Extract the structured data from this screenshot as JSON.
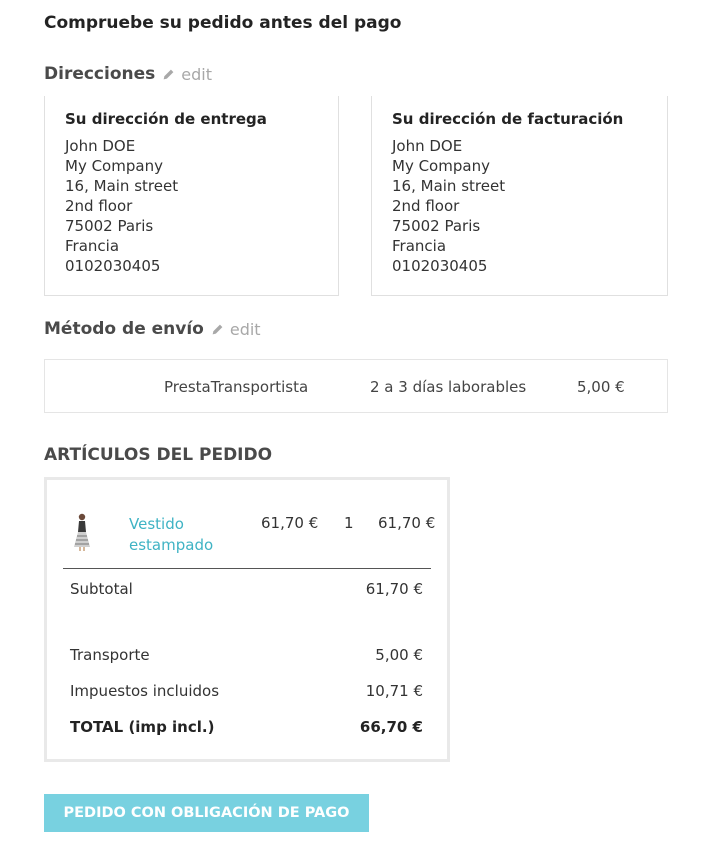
{
  "page_title": "Compruebe su pedido antes del pago",
  "addresses": {
    "section_title": "Direcciones",
    "edit_label": "edit",
    "delivery": {
      "title": "Su dirección de entrega",
      "lines": [
        "John DOE",
        "My Company",
        "16, Main street",
        "2nd floor",
        "75002 Paris",
        "Francia",
        "0102030405"
      ]
    },
    "billing": {
      "title": "Su dirección de facturación",
      "lines": [
        "John DOE",
        "My Company",
        "16, Main street",
        "2nd floor",
        "75002 Paris",
        "Francia",
        "0102030405"
      ]
    }
  },
  "shipping": {
    "section_title": "Método de envío",
    "edit_label": "edit",
    "carrier": "PrestaTransportista",
    "delay": "2 a 3 días laborables",
    "price": "5,00 €"
  },
  "items": {
    "section_title": "ARTÍCULOS DEL PEDIDO",
    "products": [
      {
        "name": "Vestido estampado",
        "unit_price": "61,70 €",
        "quantity": "1",
        "total": "61,70 €",
        "thumbnail_icon": "dress-thumbnail"
      }
    ],
    "subtotal_label": "Subtotal",
    "subtotal_value": "61,70 €",
    "shipping_label": "Transporte",
    "shipping_value": "5,00 €",
    "tax_label": "Impuestos incluidos",
    "tax_value": "10,71 €",
    "total_label": "TOTAL (imp incl.)",
    "total_value": "66,70 €"
  },
  "pay_button_label": "PEDIDO CON OBLIGACIÓN DE PAGO",
  "colors": {
    "link": "#3fb3c4",
    "button": "#78d1e0",
    "edit": "#a8a8a8"
  }
}
